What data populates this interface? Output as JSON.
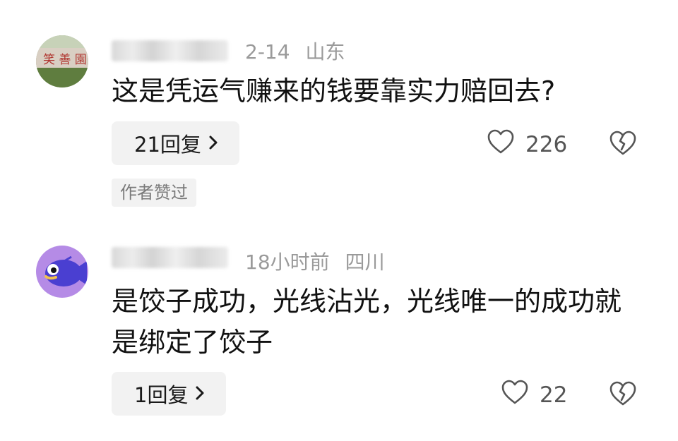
{
  "comments": [
    {
      "meta_date": "2-14",
      "meta_location": "山东",
      "text": "这是凭运气赚来的钱要靠实力赔回去?",
      "reply_label": "21回复",
      "like_count": "226",
      "author_liked_label": "作者赞过"
    },
    {
      "meta_date": "18小时前",
      "meta_location": "四川",
      "text": "是饺子成功，光线沾光，光线唯一的成功就是绑定了饺子",
      "reply_label": "1回复",
      "like_count": "22"
    }
  ],
  "icons": {
    "reply_chevron": "chevron-right-icon",
    "like": "heart-outline-icon",
    "dislike": "broken-heart-icon"
  },
  "colors": {
    "meta_text": "#9a9a9a",
    "button_bg": "#f2f2f2",
    "avatar2_bg": "#b58be6",
    "avatar2_fish": "#4a3fd1"
  }
}
